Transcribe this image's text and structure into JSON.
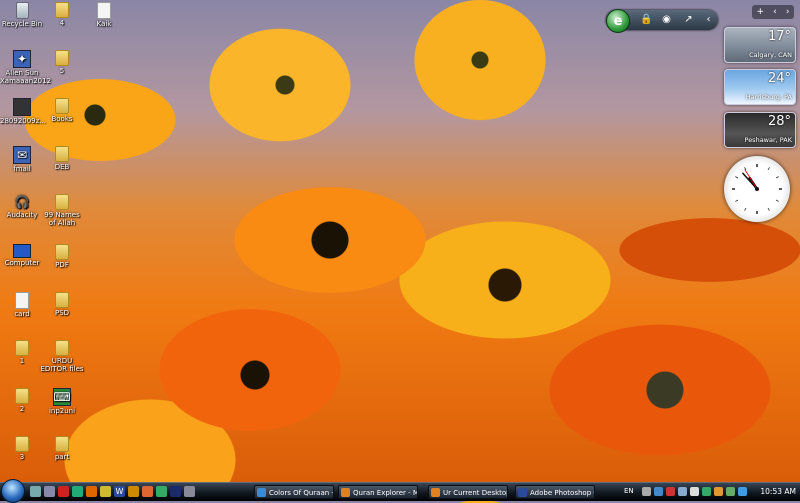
{
  "desktop_icons": [
    {
      "label": "Recycle Bin",
      "icon": "recycle-bin-icon",
      "type": "bin"
    },
    {
      "label": "4",
      "icon": "folder-icon",
      "type": "folder"
    },
    {
      "label": "Kaik",
      "icon": "document-icon",
      "type": "file"
    },
    {
      "label": "Alien Sun Xamaaan2012",
      "icon": "app-icon",
      "type": "app"
    },
    {
      "label": "5",
      "icon": "folder-icon",
      "type": "folder"
    },
    {
      "label": "28092009z...",
      "icon": "document-icon",
      "type": "app"
    },
    {
      "label": "Books",
      "icon": "folder-icon",
      "type": "folder"
    },
    {
      "label": "fmail",
      "icon": "app-icon",
      "type": "app"
    },
    {
      "label": "DEB",
      "icon": "folder-icon",
      "type": "folder"
    },
    {
      "label": "Audacity",
      "icon": "headphones-icon",
      "type": "headphone"
    },
    {
      "label": "99 Names of Allah",
      "icon": "folder-icon",
      "type": "folder"
    },
    {
      "label": "Computer",
      "icon": "computer-icon",
      "type": "pc"
    },
    {
      "label": "PDF",
      "icon": "folder-icon",
      "type": "folder"
    },
    {
      "label": "card",
      "icon": "document-icon",
      "type": "file"
    },
    {
      "label": "PSD",
      "icon": "folder-icon",
      "type": "folder"
    },
    {
      "label": "1",
      "icon": "folder-icon",
      "type": "folder"
    },
    {
      "label": "URDU EDITOR files",
      "icon": "folder-icon",
      "type": "folder"
    },
    {
      "label": "2",
      "icon": "folder-icon",
      "type": "folder"
    },
    {
      "label": "inp2uni",
      "icon": "app-icon",
      "type": "app"
    },
    {
      "label": "3",
      "icon": "folder-icon",
      "type": "folder"
    },
    {
      "label": "part",
      "icon": "folder-icon",
      "type": "folder"
    }
  ],
  "sidebar": {
    "toolbar": {
      "add": "+",
      "prev": "‹",
      "next": "›"
    },
    "weather": [
      {
        "temp": "17°",
        "city": "Calgary, CAN"
      },
      {
        "temp": "24°",
        "city": "Harrisburg, PA"
      },
      {
        "temp": "28°",
        "city": "Peshawar, PAK"
      }
    ],
    "clock": {
      "hour": 10,
      "minute": 53
    }
  },
  "top_gadget": {
    "browser_letter": "e"
  },
  "taskbar": {
    "tasks": [
      {
        "label": "Colors Of Quraan - ...",
        "color": "#3a8ad6"
      },
      {
        "label": "Quran Explorer - Mo...",
        "color": "#e08020"
      },
      {
        "label": "Ur Current Desktop ...",
        "color": "#e08020"
      },
      {
        "label": "Adobe Photoshop C...",
        "color": "#2a4a9a"
      }
    ],
    "language": "EN",
    "time": "10:53 AM"
  }
}
